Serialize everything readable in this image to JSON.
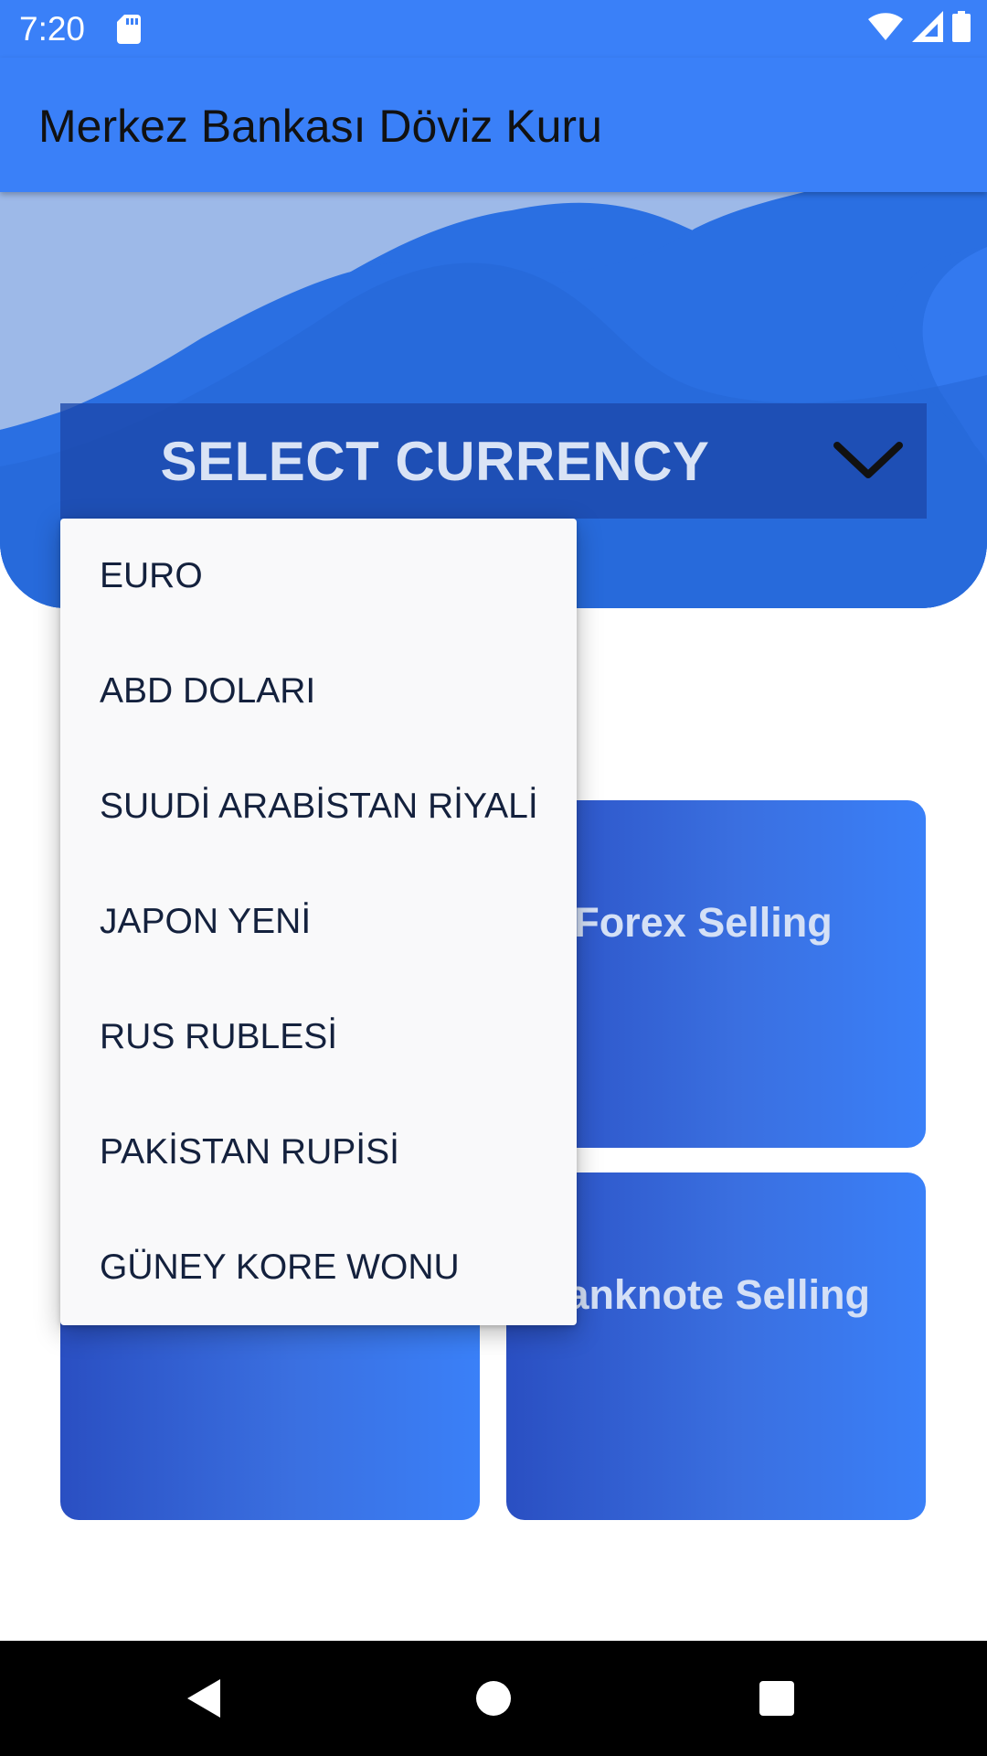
{
  "status_bar": {
    "time": "7:20",
    "icons": [
      "sd-card-icon",
      "wifi-icon",
      "signal-icon",
      "battery-icon"
    ]
  },
  "app_bar": {
    "title": "Merkez Bankası Döviz Kuru"
  },
  "select": {
    "label": "SELECT CURRENCY",
    "icon": "chevron-down-icon"
  },
  "dropdown": {
    "items": [
      "EURO",
      "ABD DOLARI",
      "SUUDİ ARABİSTAN RİYALİ",
      "JAPON YENİ",
      "RUS RUBLESİ",
      "PAKİSTAN RUPİSİ",
      "GÜNEY KORE WONU"
    ]
  },
  "cards": {
    "forex_selling": "Forex Selling",
    "banknote_selling": "Banknote Selling"
  },
  "nav_bar": {
    "icons": [
      "back-icon",
      "home-icon",
      "recents-icon"
    ]
  },
  "colors": {
    "primary": "#3a80f8",
    "hero": "#2a70e2",
    "card_gradient_start": "#2a4fc2",
    "card_gradient_end": "#3a80f8",
    "menu_background": "#f9f9fa",
    "menu_text": "#14213d"
  }
}
